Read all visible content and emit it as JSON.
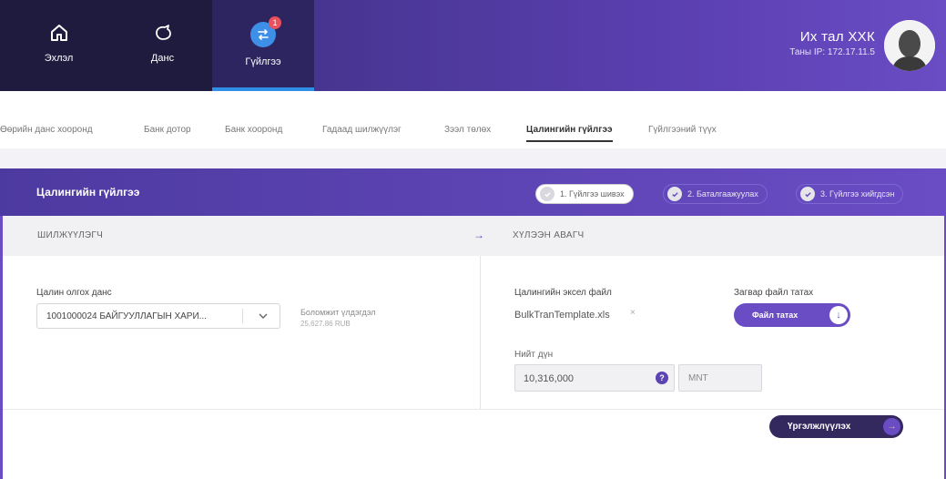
{
  "nav": {
    "home_label": "Эхлэл",
    "account_label": "Данс",
    "transfer_label": "Гүйлгээ",
    "transfer_badge": "1"
  },
  "user": {
    "name": "Их тал ХХК",
    "ip": "Таны IP: 172.17.11.5"
  },
  "subtabs": [
    "Өөрийн данс хооронд",
    "Банк дотор",
    "Банк хооронд",
    "Гадаад шилжүүлэг",
    "Зээл төлөх",
    "Цалингийн гүйлгээ",
    "Гүйлгээний түүх"
  ],
  "page": {
    "title": "Цалингийн гүйлгээ",
    "steps": [
      "1. Гүйлгээ шивэх",
      "2. Баталгаажуулах",
      "3. Гүйлгээ хийгдсэн"
    ]
  },
  "sender": {
    "header": "ШИЛЖҮҮЛЭГЧ",
    "account_label": "Цалин олгох данс",
    "account_value": "1001000024 БАЙГУУЛЛАГЫН ХАРИ...",
    "available_label": "Боломжит үлдэгдэл",
    "available_value": "25,627.86 RUB"
  },
  "receiver": {
    "header": "ХҮЛЭЭН АВАГЧ",
    "excel_label": "Цалингийн эксел файл",
    "file_name": "BulkTranTemplate.xls",
    "remove_icon": "×",
    "template_label": "Загвар файл татах",
    "download_button": "Файл татах",
    "total_label": "Нийт дүн",
    "total_value": "10,316,000",
    "currency": "MNT"
  },
  "actions": {
    "continue_button": "Үргэлжлүүлэх"
  },
  "colors": {
    "brand": "#6a4cc4",
    "dark_nav": "#1f1b3f",
    "active_tab_underline": "#2f8fe6",
    "badge": "#e8505b"
  }
}
